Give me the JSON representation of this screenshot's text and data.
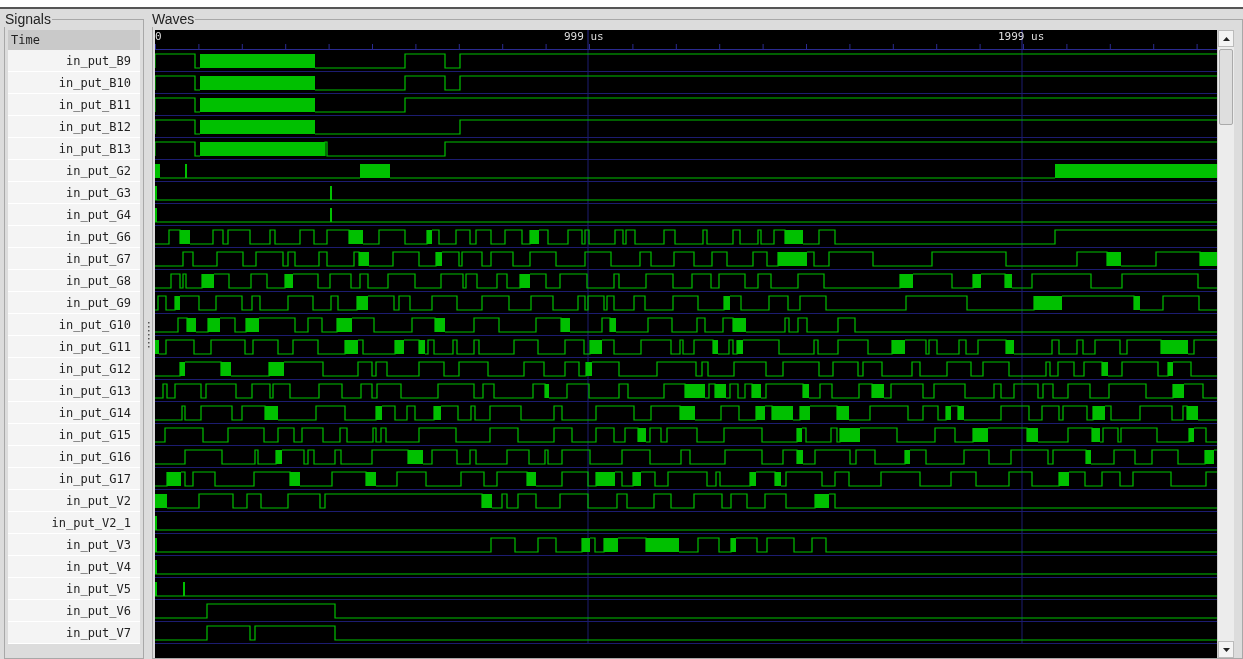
{
  "signals_panel": {
    "title": "Signals",
    "header": "Time",
    "signals": [
      {
        "name": "in_put_B9"
      },
      {
        "name": "in_put_B10"
      },
      {
        "name": "in_put_B11"
      },
      {
        "name": "in_put_B12"
      },
      {
        "name": "in_put_B13"
      },
      {
        "name": "in_put_G2"
      },
      {
        "name": "in_put_G3"
      },
      {
        "name": "in_put_G4"
      },
      {
        "name": "in_put_G6"
      },
      {
        "name": "in_put_G7"
      },
      {
        "name": "in_put_G8"
      },
      {
        "name": "in_put_G9"
      },
      {
        "name": "in_put_G10"
      },
      {
        "name": "in_put_G11"
      },
      {
        "name": "in_put_G12"
      },
      {
        "name": "in_put_G13"
      },
      {
        "name": "in_put_G14"
      },
      {
        "name": "in_put_G15"
      },
      {
        "name": "in_put_G16"
      },
      {
        "name": "in_put_G17"
      },
      {
        "name": "in_put_V2"
      },
      {
        "name": "in_put_V2_1"
      },
      {
        "name": "in_put_V3"
      },
      {
        "name": "in_put_V4"
      },
      {
        "name": "in_put_V5"
      },
      {
        "name": "in_put_V6"
      },
      {
        "name": "in_put_V7"
      }
    ]
  },
  "waves_panel": {
    "title": "Waves",
    "time_labels": [
      "0",
      "999 us",
      "1999 us"
    ]
  }
}
